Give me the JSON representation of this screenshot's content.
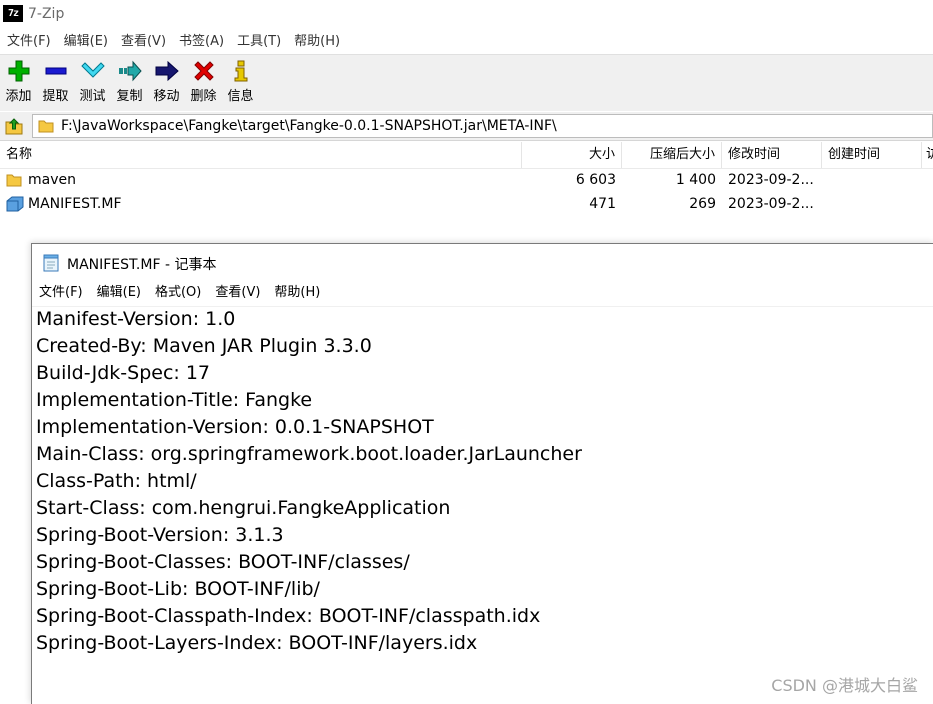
{
  "app": {
    "title": "7-Zip",
    "logo_text": "7z"
  },
  "menu": [
    "文件(F)",
    "编辑(E)",
    "查看(V)",
    "书签(A)",
    "工具(T)",
    "帮助(H)"
  ],
  "toolbar": {
    "add_label": "添加",
    "extract_label": "提取",
    "test_label": "测试",
    "copy_label": "复制",
    "move_label": "移动",
    "delete_label": "删除",
    "info_label": "信息"
  },
  "address": {
    "path": "F:\\JavaWorkspace\\Fangke\\target\\Fangke-0.0.1-SNAPSHOT.jar\\META-INF\\"
  },
  "file_list": {
    "columns": {
      "name": "名称",
      "size": "大小",
      "packed": "压缩后大小",
      "modified": "修改时间",
      "created": "创建时间",
      "extra": "访"
    },
    "rows": [
      {
        "icon": "folder-icon",
        "name": "maven",
        "size": "6 603",
        "packed": "1 400",
        "modified": "2023-09-2..."
      },
      {
        "icon": "file-icon",
        "name": "MANIFEST.MF",
        "size": "471",
        "packed": "269",
        "modified": "2023-09-2..."
      }
    ]
  },
  "notepad": {
    "title": "MANIFEST.MF - 记事本",
    "menu": {
      "file": "文件(F)",
      "edit": "编辑(E)",
      "format": "格式(O)",
      "view": "查看(V)",
      "help": "帮助(H)"
    },
    "lines": [
      "Manifest-Version: 1.0",
      "Created-By: Maven JAR Plugin 3.3.0",
      "Build-Jdk-Spec: 17",
      "Implementation-Title: Fangke",
      "Implementation-Version: 0.0.1-SNAPSHOT",
      "Main-Class: org.springframework.boot.loader.JarLauncher",
      "Class-Path: html/",
      "Start-Class: com.hengrui.FangkeApplication",
      "Spring-Boot-Version: 3.1.3",
      "Spring-Boot-Classes: BOOT-INF/classes/",
      "Spring-Boot-Lib: BOOT-INF/lib/",
      "Spring-Boot-Classpath-Index: BOOT-INF/classpath.idx",
      "Spring-Boot-Layers-Index: BOOT-INF/layers.idx"
    ]
  },
  "watermark": "CSDN @港城大白鲨",
  "colors": {
    "add": "#00b000",
    "extract": "#1a1ad0",
    "test": "#00a8c8",
    "copy": "#1a8a8a",
    "move": "#16166e",
    "delete": "#e00000",
    "info": "#e6c800",
    "folder": "#f5c842"
  }
}
